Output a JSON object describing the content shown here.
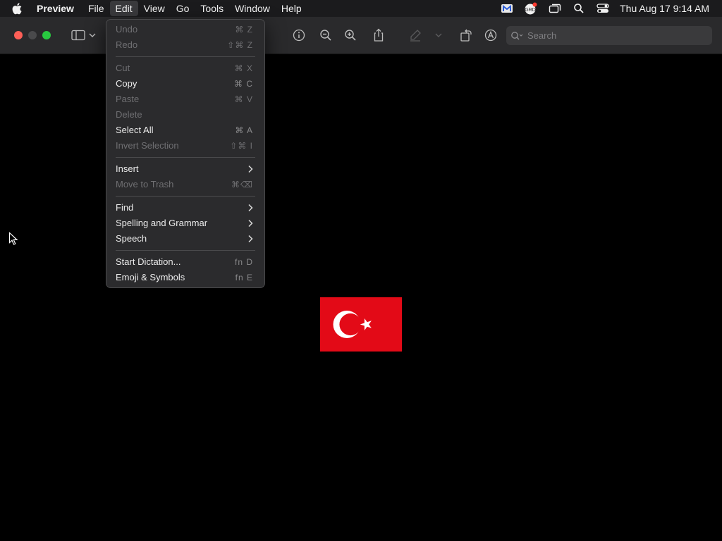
{
  "menubar": {
    "app_name": "Preview",
    "items": [
      "File",
      "Edit",
      "View",
      "Go",
      "Tools",
      "Window",
      "Help"
    ],
    "active_item": "Edit",
    "clock": "Thu Aug 17  9:14 AM"
  },
  "toolbar": {
    "search_placeholder": "Search"
  },
  "edit_menu": {
    "groups": [
      [
        {
          "label": "Undo",
          "shortcut": "⌘ Z",
          "enabled": false
        },
        {
          "label": "Redo",
          "shortcut": "⇧⌘ Z",
          "enabled": false
        }
      ],
      [
        {
          "label": "Cut",
          "shortcut": "⌘ X",
          "enabled": false
        },
        {
          "label": "Copy",
          "shortcut": "⌘ C",
          "enabled": true
        },
        {
          "label": "Paste",
          "shortcut": "⌘ V",
          "enabled": false
        },
        {
          "label": "Delete",
          "shortcut": "",
          "enabled": false
        },
        {
          "label": "Select All",
          "shortcut": "⌘ A",
          "enabled": true
        },
        {
          "label": "Invert Selection",
          "shortcut": "⇧⌘ I",
          "enabled": false
        }
      ],
      [
        {
          "label": "Insert",
          "submenu": true,
          "enabled": true
        },
        {
          "label": "Move to Trash",
          "shortcut": "⌘⌫",
          "enabled": false
        }
      ],
      [
        {
          "label": "Find",
          "submenu": true,
          "enabled": true
        },
        {
          "label": "Spelling and Grammar",
          "submenu": true,
          "enabled": true
        },
        {
          "label": "Speech",
          "submenu": true,
          "enabled": true
        }
      ],
      [
        {
          "label": "Start Dictation...",
          "shortcut": "fn D",
          "enabled": true
        },
        {
          "label": "Emoji & Symbols",
          "shortcut": "fn E",
          "enabled": true
        }
      ]
    ]
  },
  "document": {
    "image_subject": "turkey-flag",
    "flag_colors": {
      "red": "#e30a17",
      "white": "#ffffff"
    }
  },
  "colors": {
    "close": "#fe5f57",
    "minimize": "#4a4a4c",
    "zoom": "#28c840",
    "menubar_bg": "#1b1b1d",
    "toolbar_bg": "#2a2a2c",
    "menu_bg": "#2b2b2d"
  }
}
